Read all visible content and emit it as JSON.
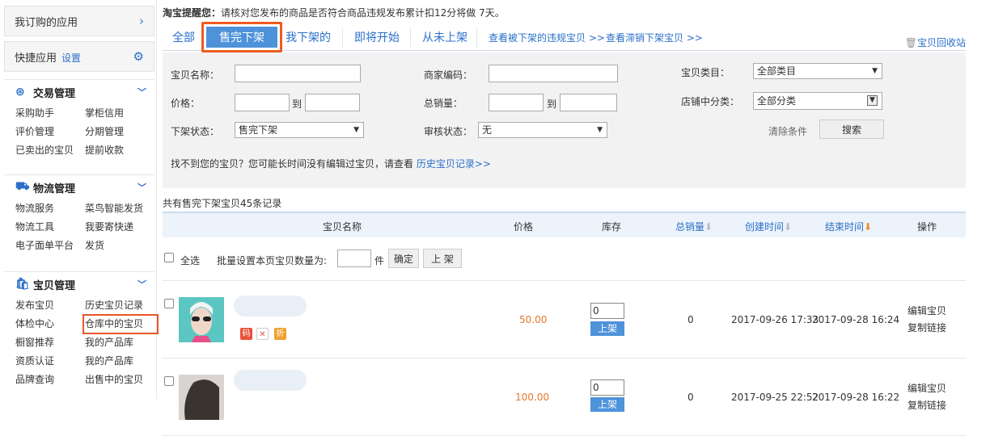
{
  "sidebar": {
    "subscribed": "我订购的应用",
    "quick": "快捷应用",
    "settings": "设置",
    "sections": [
      {
        "title": "交易管理",
        "items": [
          "采购助手",
          "掌柜信用",
          "评价管理",
          "分期管理",
          "已卖出的宝贝",
          "提前收款"
        ]
      },
      {
        "title": "物流管理",
        "items": [
          "物流服务",
          "菜鸟智能发货",
          "物流工具",
          "我要寄快递",
          "电子面单平台",
          "发货"
        ]
      },
      {
        "title": "宝贝管理",
        "items": [
          "发布宝贝",
          "历史宝贝记录",
          "体检中心",
          "仓库中的宝贝",
          "橱窗推荐",
          "我的产品库",
          "资质认证",
          "我的产品库",
          "品牌查询",
          "出售中的宝贝"
        ]
      }
    ]
  },
  "notice": {
    "label": "淘宝提醒您：",
    "text": "请核对您发布的商品是否符合商品违规发布累计扣12分将做 7天。"
  },
  "tabs": {
    "all": "全部",
    "sold_out": "售完下架",
    "mine": "我下架的",
    "upcoming": "即将开始",
    "never": "从未上架",
    "violation_link": "查看被下架的违规宝贝 >>",
    "unsold_link": "查看滞销下架宝贝 >>",
    "recycle": "宝贝回收站"
  },
  "filters": {
    "name_label": "宝贝名称：",
    "code_label": "商家编码：",
    "category_label": "宝贝类目：",
    "category_value": "全部类目",
    "price_label": "价格：",
    "to1": "到",
    "sales_label": "总销量：",
    "to2": "到",
    "shop_cat_label": "店铺中分类：",
    "shop_cat_value": "全部分类",
    "status_label": "下架状态：",
    "status_value": "售完下架",
    "audit_label": "审核状态：",
    "audit_value": "无",
    "clear": "清除条件",
    "search": "搜索",
    "hint": "找不到您的宝贝？您可能长时间没有编辑过宝贝，请查看",
    "history_link": "历史宝贝记录>>"
  },
  "list": {
    "count_text": "共有售完下架宝贝45条记录",
    "headers": [
      "宝贝名称",
      "价格",
      "库存",
      "总销量",
      "创建时间",
      "结束时间",
      "操作"
    ],
    "select_all": "全选",
    "batch_label": "批量设置本页宝贝数量为:",
    "unit": "件",
    "confirm": "确定",
    "shelve": "上 架",
    "rows": [
      {
        "price": "50.00",
        "stock": "0",
        "up": "上架",
        "sales": "0",
        "created": "2017-09-26 17:33",
        "ended": "2017-09-28 16:24",
        "edit": "编辑宝贝",
        "copy": "复制链接",
        "badges": [
          "码",
          "✕",
          "折"
        ]
      },
      {
        "price": "100.00",
        "stock": "0",
        "up": "上架",
        "sales": "0",
        "created": "2017-09-25 22:52",
        "ended": "2017-09-28 16:22",
        "edit": "编辑宝贝",
        "copy": "复制链接"
      }
    ]
  },
  "colors": {
    "accent": "#2a6fc9",
    "active_tab": "#4e92da",
    "highlight_border": "#f05a1e",
    "price": "#e8762a"
  }
}
